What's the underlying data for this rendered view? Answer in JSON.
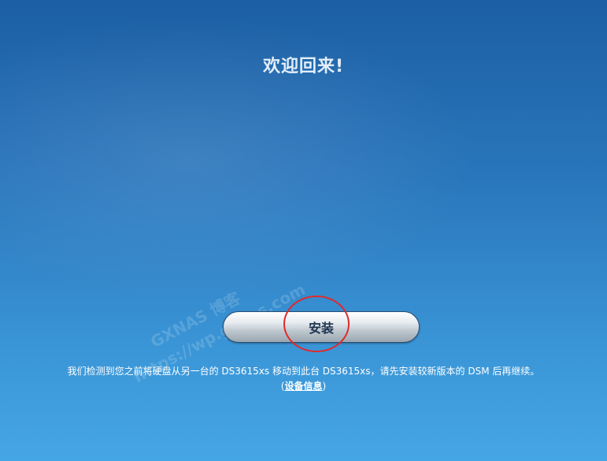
{
  "page": {
    "title": "欢迎回来!"
  },
  "install": {
    "label": "安装"
  },
  "message": {
    "text": "我们检测到您之前将硬盘从另一台的 DS3615xs 移动到此台 DS3615xs，请先安装较新版本的 DSM 后再继续。",
    "paren_open": "(",
    "device_info_label": "设备信息",
    "paren_close": ")"
  },
  "watermark": {
    "line1": "GXNAS 博客",
    "line2": "https://wp.gxnas.com"
  },
  "colors": {
    "background_top": "#1c5fa3",
    "background_bottom": "#45a6e6",
    "annotation_circle": "#e02a2a"
  }
}
